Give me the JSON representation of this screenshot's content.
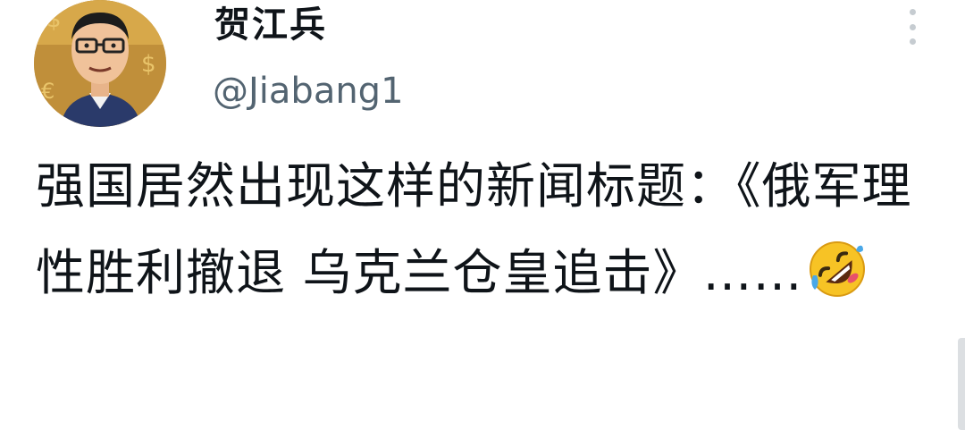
{
  "tweet": {
    "display_name": "贺江兵",
    "handle": "@Jiabang1",
    "text": "强国居然出现这样的新闻标题：《俄军理性胜利撤退 乌克兰仓皇追击》……",
    "emoji": "rolling-on-floor-laughing"
  },
  "icons": {
    "avatar": "cartoon-man-with-glasses-avatar",
    "more": "more-options-icon"
  },
  "colors": {
    "text": "#0f1419",
    "handle": "#536471",
    "emoji": "#f7c325"
  }
}
